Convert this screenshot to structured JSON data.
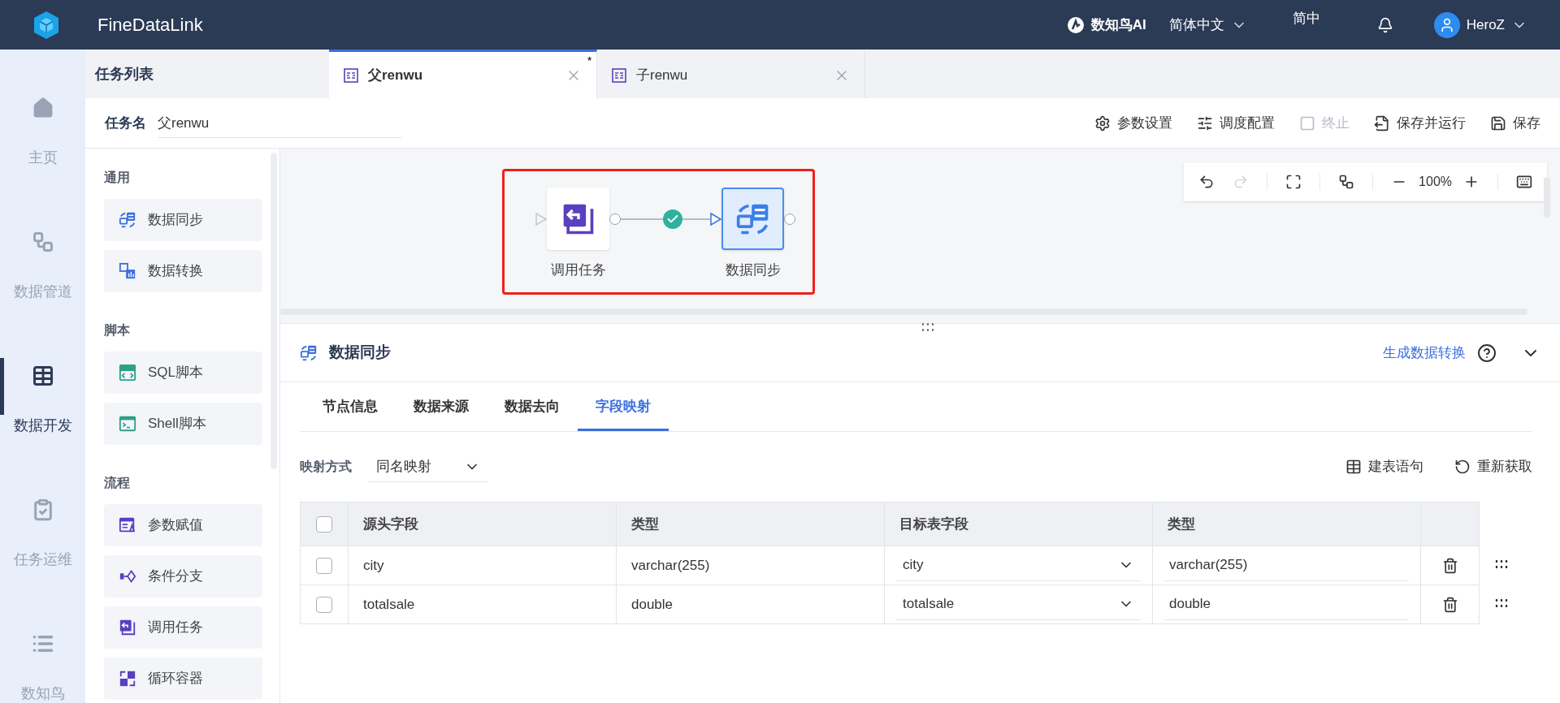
{
  "header": {
    "app_name": "FineDataLink",
    "ai_label": "数知鸟AI",
    "language": "简体中文",
    "input_mode": "简中",
    "user": "HeroZ"
  },
  "rail": [
    {
      "label": "主页",
      "selected": false
    },
    {
      "label": "数据管道",
      "selected": false
    },
    {
      "label": "数据开发",
      "selected": true
    },
    {
      "label": "任务运维",
      "selected": false
    },
    {
      "label": "数知鸟",
      "selected": false
    }
  ],
  "task_list_title": "任务列表",
  "tabs": [
    {
      "label": "父renwu",
      "selected": true,
      "marker": "*"
    },
    {
      "label": "子renwu",
      "selected": false
    }
  ],
  "task_name": {
    "label": "任务名",
    "value": "父renwu"
  },
  "toolbar": [
    {
      "label": "参数设置",
      "disabled": false
    },
    {
      "label": "调度配置",
      "disabled": false
    },
    {
      "label": "终止",
      "disabled": true
    },
    {
      "label": "保存并运行",
      "disabled": false
    },
    {
      "label": "保存",
      "disabled": false
    }
  ],
  "palette": [
    {
      "title": "通用",
      "items": [
        "数据同步",
        "数据转换"
      ]
    },
    {
      "title": "脚本",
      "items": [
        "SQL脚本",
        "Shell脚本"
      ]
    },
    {
      "title": "流程",
      "items": [
        "参数赋值",
        "条件分支",
        "调用任务",
        "循环容器"
      ]
    }
  ],
  "canvas": {
    "nodes": [
      {
        "label": "调用任务",
        "selected": false
      },
      {
        "label": "数据同步",
        "selected": true
      }
    ],
    "zoom": "100%"
  },
  "detail": {
    "title": "数据同步",
    "action": "生成数据转换",
    "tabs": [
      {
        "label": "节点信息",
        "selected": false
      },
      {
        "label": "数据来源",
        "selected": false
      },
      {
        "label": "数据去向",
        "selected": false
      },
      {
        "label": "字段映射",
        "selected": true
      }
    ],
    "mapping_label": "映射方式",
    "mapping_value": "同名映射",
    "actions": [
      "建表语句",
      "重新获取"
    ],
    "select_all_checked": false,
    "columns": [
      "源头字段",
      "类型",
      "目标表字段",
      "类型"
    ],
    "rows": [
      {
        "checked": false,
        "source": "city",
        "source_type": "varchar(255)",
        "target": "city",
        "target_type": "varchar(255)"
      },
      {
        "checked": false,
        "source": "totalsale",
        "source_type": "double",
        "target": "totalsale",
        "target_type": "double"
      }
    ]
  }
}
